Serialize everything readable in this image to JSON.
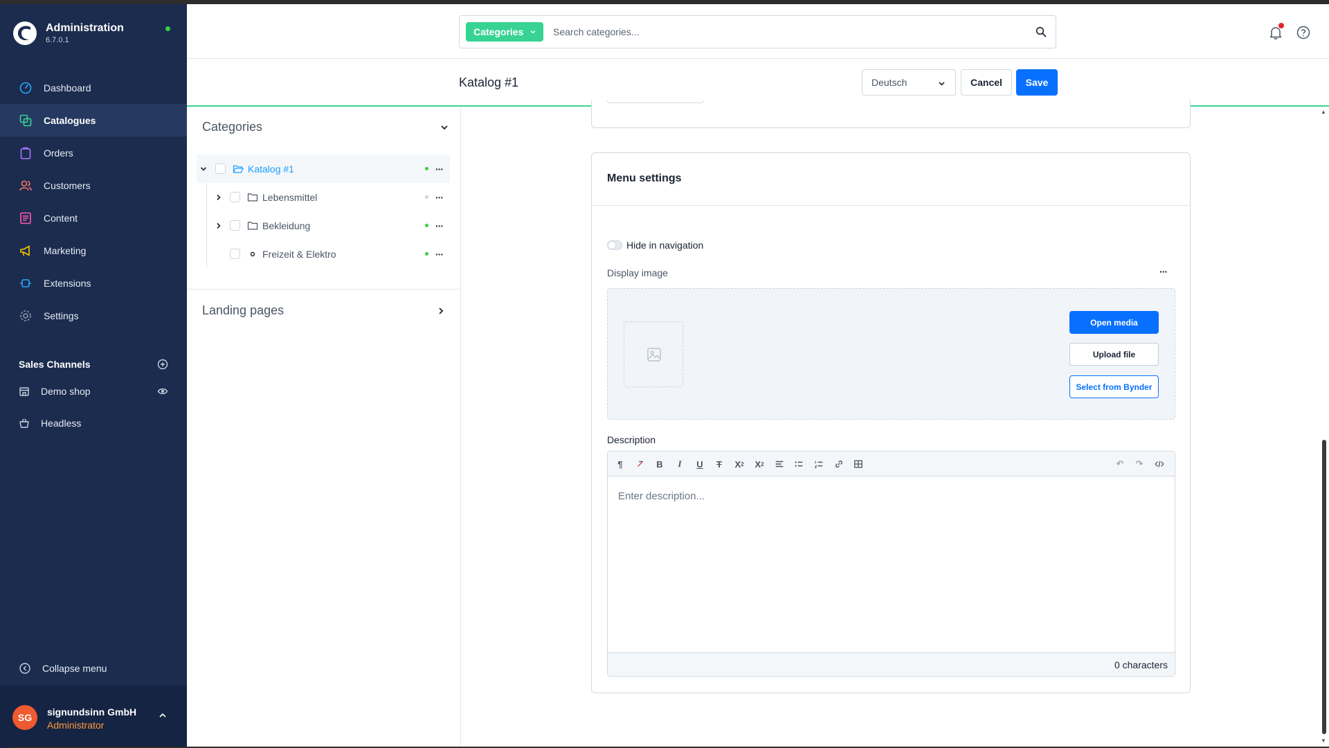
{
  "brand": {
    "title": "Administration",
    "version": "6.7.0.1"
  },
  "nav": {
    "items": [
      {
        "label": "Dashboard",
        "icon": "dashboard-icon"
      },
      {
        "label": "Catalogues",
        "icon": "catalogue-icon",
        "active": true
      },
      {
        "label": "Orders",
        "icon": "orders-icon"
      },
      {
        "label": "Customers",
        "icon": "customers-icon"
      },
      {
        "label": "Content",
        "icon": "content-icon"
      },
      {
        "label": "Marketing",
        "icon": "marketing-icon"
      },
      {
        "label": "Extensions",
        "icon": "extensions-icon"
      },
      {
        "label": "Settings",
        "icon": "settings-icon"
      }
    ]
  },
  "sales_channels": {
    "title": "Sales Channels",
    "items": [
      {
        "label": "Demo shop",
        "icon": "storefront-icon"
      },
      {
        "label": "Headless",
        "icon": "basket-icon"
      }
    ]
  },
  "sidebar_footer": {
    "collapse_label": "Collapse menu",
    "user_initials": "SG",
    "user_name": "signundsinn GmbH",
    "user_role": "Administrator"
  },
  "header": {
    "search_type": "Categories",
    "search_placeholder": "Search categories..."
  },
  "toolbar": {
    "title": "Katalog #1",
    "language": "Deutsch",
    "cancel_label": "Cancel",
    "save_label": "Save"
  },
  "categories": {
    "title": "Categories",
    "tree": [
      {
        "label": "Katalog #1",
        "status": "active",
        "expanded": true,
        "selected": true
      },
      {
        "label": "Lebensmittel",
        "status": "inactive",
        "expanded": false
      },
      {
        "label": "Bekleidung",
        "status": "active",
        "expanded": false
      },
      {
        "label": "Freizeit & Elektro",
        "status": "active",
        "leaf": true
      }
    ],
    "landing_title": "Landing pages"
  },
  "menu_settings": {
    "title": "Menu settings",
    "hide_label": "Hide in navigation",
    "display_image_label": "Display image",
    "open_media": "Open media",
    "upload_file": "Upload file",
    "select_bynder": "Select from Bynder",
    "description_label": "Description",
    "description_placeholder": "Enter description...",
    "char_count": "0 characters"
  },
  "colors": {
    "sidebar": "#1b2c4e",
    "accent_green": "#37d393",
    "primary_blue": "#0870ff",
    "status_green": "#37d046"
  }
}
